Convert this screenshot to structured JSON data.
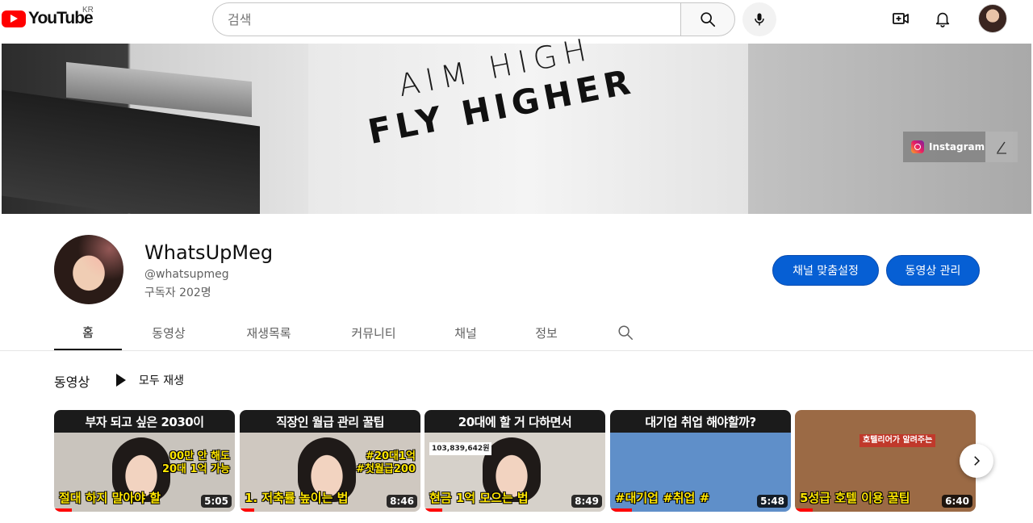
{
  "header": {
    "logo_text": "YouTube",
    "country_code": "KR",
    "search_placeholder": "검색"
  },
  "banner": {
    "line1": "AIM HIGH",
    "line2": "FLY HIGHER",
    "link_label": "Instagram"
  },
  "channel": {
    "name": "WhatsUpMeg",
    "handle": "@whatsupmeg",
    "subscribers": "구독자 202명",
    "customize_button": "채널 맞춤설정",
    "manage_button": "동영상 관리"
  },
  "tabs": [
    {
      "label": "홈",
      "active": true
    },
    {
      "label": "동영상",
      "active": false
    },
    {
      "label": "재생목록",
      "active": false
    },
    {
      "label": "커뮤니티",
      "active": false
    },
    {
      "label": "채널",
      "active": false
    },
    {
      "label": "정보",
      "active": false
    }
  ],
  "videos_section": {
    "title": "동영상",
    "play_all": "모두 재생"
  },
  "videos": [
    {
      "top_text": "부자 되고 싶은 2030이",
      "mid_text": "00만 안 해도\n20대 1억 가능",
      "bottom_text": "절대 하지 말아야 할",
      "duration": "5:05",
      "watched_pct": 10,
      "bg": "#c9c4bd"
    },
    {
      "top_text": "직장인 월급 관리 꿀팁",
      "mid_text": "#20대1억\n#첫월급200",
      "bottom_text": "1. 저축률 높이는 법",
      "duration": "8:46",
      "watched_pct": 8,
      "bg": "#cfc8c0"
    },
    {
      "top_text": "20대에 할 거 다하면서",
      "mid_text": "103,839,642원",
      "bottom_text": "현금 1억 모으는 법",
      "duration": "8:49",
      "watched_pct": 10,
      "bg": "#d6d1ca"
    },
    {
      "top_text": "대기업 취업 해야할까?",
      "mid_text": "",
      "bottom_text": "#대기업 #취업 #",
      "duration": "5:48",
      "watched_pct": 12,
      "bg": "#5f8fc9"
    },
    {
      "top_text": "",
      "mid_text": "호텔리어가 알려주는",
      "bottom_text": "5성급 호텔 이용 꿀팁",
      "duration": "6:40",
      "watched_pct": 10,
      "bg": "#9b6a45"
    }
  ],
  "colors": {
    "brand_red": "#ff0000",
    "button_blue": "#065fd4",
    "caption_yellow": "#ffe600"
  }
}
